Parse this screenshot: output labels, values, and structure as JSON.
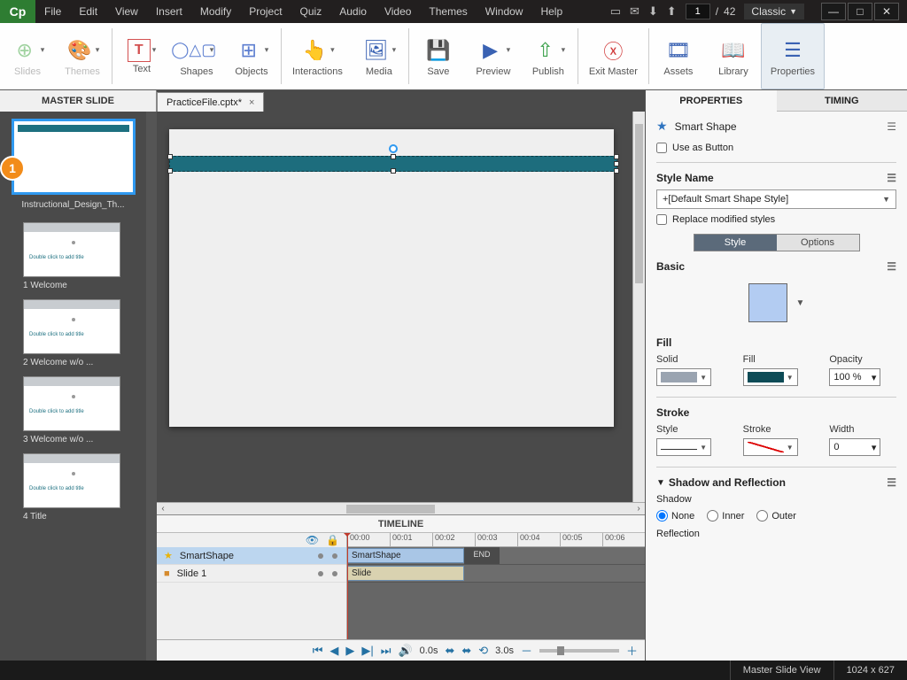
{
  "app": {
    "logo": "Cp",
    "workspace": "Classic"
  },
  "menu": [
    "File",
    "Edit",
    "View",
    "Insert",
    "Modify",
    "Project",
    "Quiz",
    "Audio",
    "Video",
    "Themes",
    "Window",
    "Help"
  ],
  "paging": {
    "current": "1",
    "total": "42"
  },
  "ribbon": {
    "slides": "Slides",
    "themes": "Themes",
    "text": "Text",
    "shapes": "Shapes",
    "objects": "Objects",
    "interactions": "Interactions",
    "media": "Media",
    "save": "Save",
    "preview": "Preview",
    "publish": "Publish",
    "exit_master": "Exit Master",
    "assets": "Assets",
    "library": "Library",
    "properties": "Properties"
  },
  "slide_panel": {
    "header": "MASTER SLIDE",
    "master_caption": "Instructional_Design_Th...",
    "badge": "1",
    "children": [
      {
        "placeholder": "Double click to add title",
        "caption": "1 Welcome"
      },
      {
        "placeholder": "Double click to add title",
        "caption": "2 Welcome w/o ..."
      },
      {
        "placeholder": "Double click to add title",
        "caption": "3 Welcome w/o ..."
      },
      {
        "placeholder": "Double click to add title",
        "caption": "4 Title"
      }
    ]
  },
  "tab": {
    "name": "PracticeFile.cptx*"
  },
  "timeline": {
    "title": "TIMELINE",
    "marks": [
      "00:00",
      "00:01",
      "00:02",
      "00:03",
      "00:04",
      "00:05",
      "00:06"
    ],
    "rows": [
      {
        "icon": "star",
        "label": "SmartShape",
        "selected": true
      },
      {
        "icon": "square",
        "label": "Slide 1",
        "selected": false
      }
    ],
    "clips": {
      "smartshape": "SmartShape",
      "slide": "Slide",
      "end": "END"
    },
    "time_readout": "0.0s",
    "zoom_readout": "3.0s"
  },
  "panel": {
    "tab_properties": "PROPERTIES",
    "tab_timing": "TIMING",
    "object_name": "Smart Shape",
    "use_as_button": "Use as Button",
    "style_name_label": "Style Name",
    "style_name": "+[Default Smart Shape Style]",
    "replace_styles": "Replace modified styles",
    "seg_style": "Style",
    "seg_options": "Options",
    "basic": "Basic",
    "fill_section": "Fill",
    "fill_solid": "Solid",
    "fill_fill": "Fill",
    "fill_opacity": "Opacity",
    "opacity_val": "100 %",
    "stroke_section": "Stroke",
    "stroke_style": "Style",
    "stroke_stroke": "Stroke",
    "stroke_width": "Width",
    "width_val": "0",
    "shadow_section": "Shadow and Reflection",
    "shadow_label": "Shadow",
    "shadow_none": "None",
    "shadow_inner": "Inner",
    "shadow_outer": "Outer",
    "reflection_label": "Reflection"
  },
  "status": {
    "view": "Master Slide View",
    "dims": "1024 x 627"
  },
  "colors": {
    "accent": "#1d7080",
    "fill_swatch": "#9aa4b1",
    "fill_color": "#0d4b56",
    "basic_swatch": "#b3ccf2"
  }
}
